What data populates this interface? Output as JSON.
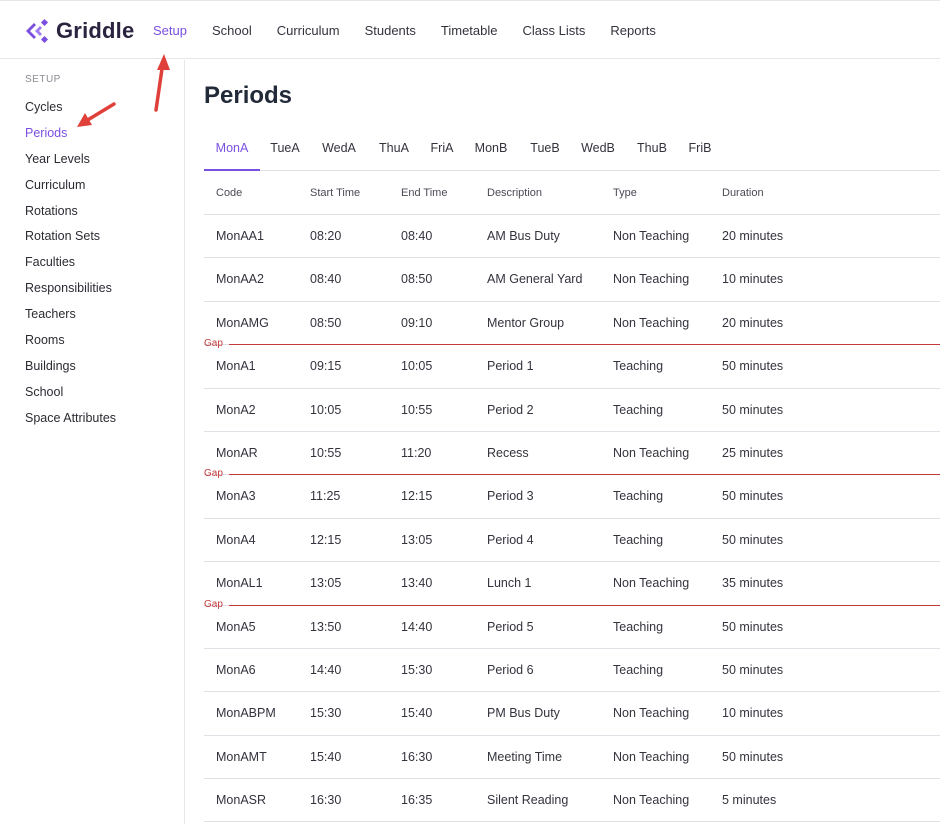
{
  "app": {
    "name": "Griddle"
  },
  "nav": [
    {
      "label": "Setup",
      "active": true
    },
    {
      "label": "School"
    },
    {
      "label": "Curriculum"
    },
    {
      "label": "Students"
    },
    {
      "label": "Timetable"
    },
    {
      "label": "Class Lists"
    },
    {
      "label": "Reports"
    }
  ],
  "sidebar": {
    "heading": "SETUP",
    "items": [
      {
        "label": "Cycles"
      },
      {
        "label": "Periods",
        "active": true
      },
      {
        "label": "Year Levels"
      },
      {
        "label": "Curriculum"
      },
      {
        "label": "Rotations"
      },
      {
        "label": "Rotation Sets"
      },
      {
        "label": "Faculties"
      },
      {
        "label": "Responsibilities"
      },
      {
        "label": "Teachers"
      },
      {
        "label": "Rooms"
      },
      {
        "label": "Buildings"
      },
      {
        "label": "School"
      },
      {
        "label": "Space Attributes"
      }
    ]
  },
  "page": {
    "title": "Periods"
  },
  "tabs": [
    {
      "label": "MonA",
      "active": true
    },
    {
      "label": "TueA"
    },
    {
      "label": "WedA"
    },
    {
      "label": "ThuA"
    },
    {
      "label": "FriA"
    },
    {
      "label": "MonB"
    },
    {
      "label": "TueB"
    },
    {
      "label": "WedB"
    },
    {
      "label": "ThuB"
    },
    {
      "label": "FriB"
    }
  ],
  "table": {
    "columns": [
      "Code",
      "Start Time",
      "End Time",
      "Description",
      "Type",
      "Duration"
    ],
    "gap_label": "Gap",
    "rows": [
      [
        "MonAA1",
        "08:20",
        "08:40",
        "AM Bus Duty",
        "Non Teaching",
        "20 minutes"
      ],
      [
        "MonAA2",
        "08:40",
        "08:50",
        "AM General Yard",
        "Non Teaching",
        "10 minutes"
      ],
      [
        "MonAMG",
        "08:50",
        "09:10",
        "Mentor Group",
        "Non Teaching",
        "20 minutes"
      ],
      [
        "MonA1",
        "09:15",
        "10:05",
        "Period 1",
        "Teaching",
        "50 minutes"
      ],
      [
        "MonA2",
        "10:05",
        "10:55",
        "Period 2",
        "Teaching",
        "50 minutes"
      ],
      [
        "MonAR",
        "10:55",
        "11:20",
        "Recess",
        "Non Teaching",
        "25 minutes"
      ],
      [
        "MonA3",
        "11:25",
        "12:15",
        "Period 3",
        "Teaching",
        "50 minutes"
      ],
      [
        "MonA4",
        "12:15",
        "13:05",
        "Period 4",
        "Teaching",
        "50 minutes"
      ],
      [
        "MonAL1",
        "13:05",
        "13:40",
        "Lunch 1",
        "Non Teaching",
        "35 minutes"
      ],
      [
        "MonA5",
        "13:50",
        "14:40",
        "Period 5",
        "Teaching",
        "50 minutes"
      ],
      [
        "MonA6",
        "14:40",
        "15:30",
        "Period 6",
        "Teaching",
        "50 minutes"
      ],
      [
        "MonABPM",
        "15:30",
        "15:40",
        "PM Bus Duty",
        "Non Teaching",
        "10 minutes"
      ],
      [
        "MonAMT",
        "15:40",
        "16:30",
        "Meeting Time",
        "Non Teaching",
        "50 minutes"
      ],
      [
        "MonASR",
        "16:30",
        "16:35",
        "Silent Reading",
        "Non Teaching",
        "5 minutes"
      ]
    ],
    "gaps_after_rows": [
      2,
      5,
      8
    ]
  },
  "colors": {
    "accent": "#7b4fe0",
    "gap": "#c23a3a",
    "annotation_arrow": "#e0403a"
  }
}
